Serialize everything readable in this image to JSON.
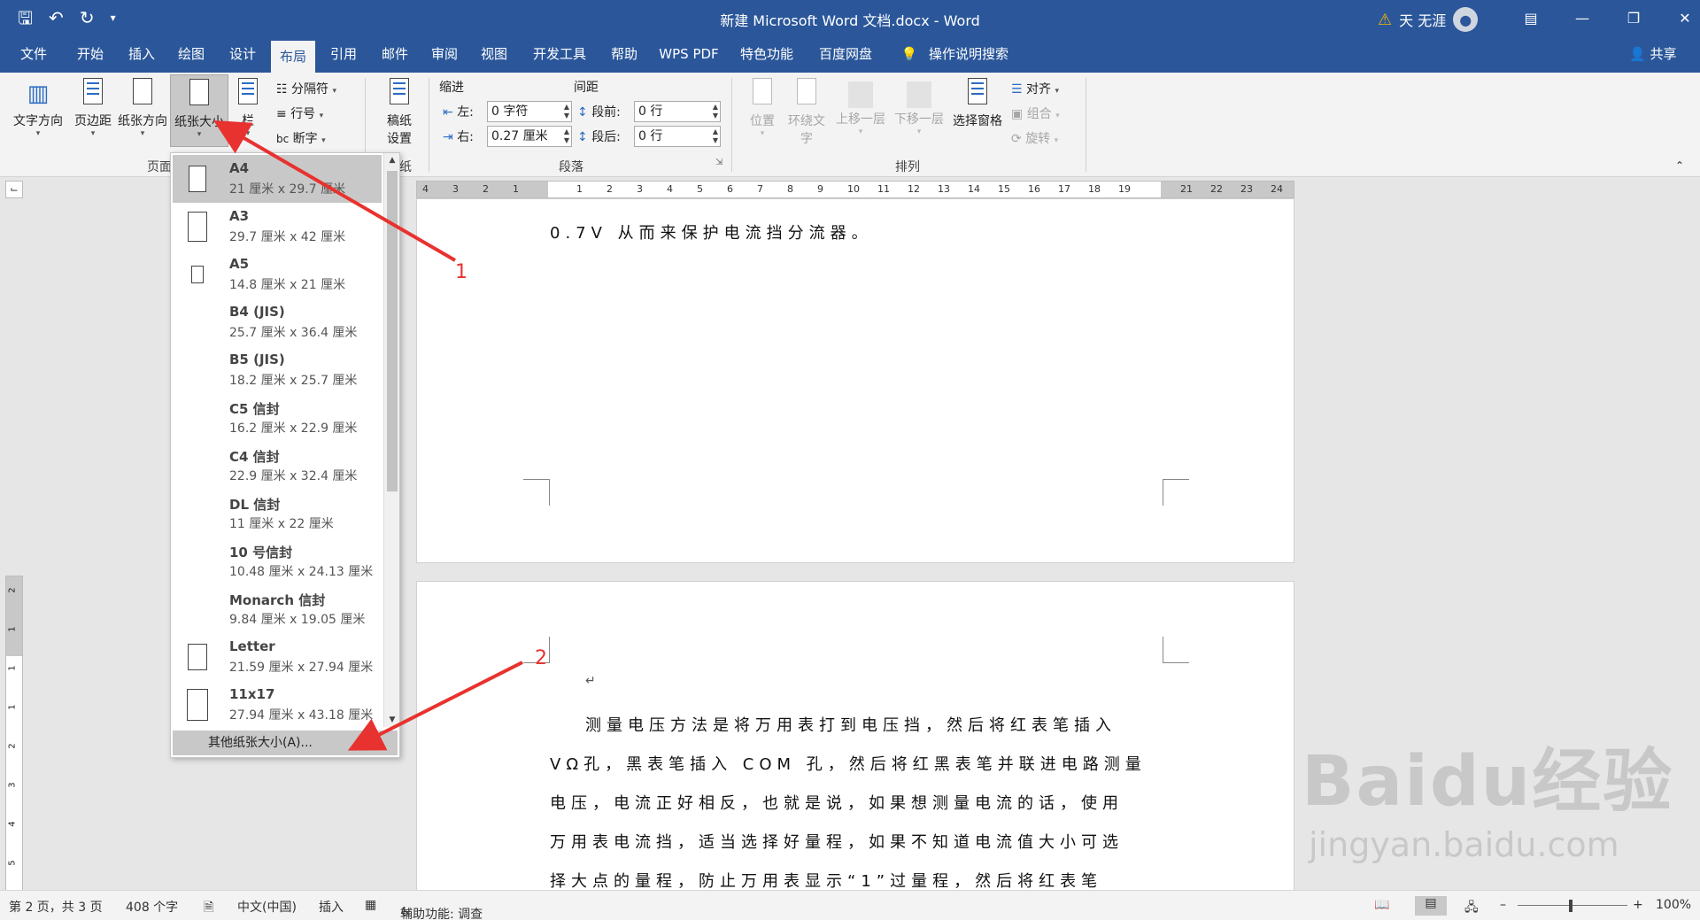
{
  "titlebar": {
    "title": "新建 Microsoft Word 文档.docx  -  Word",
    "user": "天 无涯",
    "qat": [
      "save-icon",
      "undo-icon",
      "redo-icon",
      "customize-icon"
    ],
    "window_buttons": [
      "ribbon-display-icon",
      "minimize-icon",
      "restore-icon",
      "close-icon"
    ]
  },
  "tabs": [
    "文件",
    "开始",
    "插入",
    "绘图",
    "设计",
    "布局",
    "引用",
    "邮件",
    "审阅",
    "视图",
    "开发工具",
    "帮助",
    "WPS PDF",
    "特色功能",
    "百度网盘",
    "操作说明搜索"
  ],
  "active_tab": "布局",
  "share": "共享",
  "ribbon": {
    "page_setup": {
      "text_direction": "文字方向",
      "margins": "页边距",
      "orientation": "纸张方向",
      "size": "纸张大小",
      "columns": "栏",
      "breaks": "分隔符",
      "line_numbers": "行号",
      "hyphenation": "断字",
      "group_label": "页面"
    },
    "manuscript": {
      "label": "稿纸\n设置",
      "line1": "稿纸",
      "line2": "设置",
      "group_label": "纸"
    },
    "paragraph": {
      "indent_label": "缩进",
      "spacing_label": "间距",
      "left_label": "左:",
      "left_value": "0 字符",
      "right_label": "右:",
      "right_value": "0.27 厘米",
      "before_label": "段前:",
      "before_value": "0 行",
      "after_label": "段后:",
      "after_value": "0 行",
      "group_label": "段落"
    },
    "arrange": {
      "position": "位置",
      "wrap_text_1": "环绕文",
      "wrap_text_2": "字",
      "bring_forward": "上移一层",
      "send_backward": "下移一层",
      "selection_pane": "选择窗格",
      "align": "对齐",
      "group": "组合",
      "rotate": "旋转",
      "group_label": "排列"
    }
  },
  "ruler": {
    "numbers": [
      "4",
      "3",
      "2",
      "1",
      "1",
      "2",
      "3",
      "4",
      "5",
      "6",
      "7",
      "8",
      "9",
      "10",
      "11",
      "12",
      "13",
      "14",
      "15",
      "16",
      "17",
      "18",
      "19",
      "21",
      "22",
      "23",
      "24"
    ],
    "vertical": [
      "2",
      "1",
      "1",
      "1",
      "2",
      "3",
      "4",
      "5"
    ]
  },
  "document": {
    "page1_line": "0.7V 从而来保护电流挡分流器。",
    "page2_lines": [
      "测量电压方法是将万用表打到电压挡，然后将红表笔插入",
      "VΩ孔，黑表笔插入 COM 孔，然后将红黑表笔并联进电路测量",
      "电压，电流正好相反，也就是说，如果想测量电流的话，使用",
      "万用表电流挡，适当选择好量程，如果不知道电流值大小可选",
      "择大点的量程，防止万用表显示“1”过量程，然后将红表笔"
    ]
  },
  "paper_sizes": [
    {
      "name": "A4",
      "dims": "21 厘米 x 29.7 厘米"
    },
    {
      "name": "A3",
      "dims": "29.7 厘米 x 42 厘米"
    },
    {
      "name": "A5",
      "dims": "14.8 厘米 x 21 厘米"
    },
    {
      "name": "B4 (JIS)",
      "dims": "25.7 厘米 x 36.4 厘米"
    },
    {
      "name": "B5 (JIS)",
      "dims": "18.2 厘米 x 25.7 厘米"
    },
    {
      "name": "C5 信封",
      "dims": "16.2 厘米 x 22.9 厘米"
    },
    {
      "name": "C4 信封",
      "dims": "22.9 厘米 x 32.4 厘米"
    },
    {
      "name": "DL 信封",
      "dims": "11 厘米 x 22 厘米"
    },
    {
      "name": "10 号信封",
      "dims": "10.48 厘米 x 24.13 厘米"
    },
    {
      "name": "Monarch 信封",
      "dims": "9.84 厘米 x 19.05 厘米"
    },
    {
      "name": "Letter",
      "dims": "21.59 厘米 x 27.94 厘米"
    },
    {
      "name": "11x17",
      "dims": "27.94 厘米 x 43.18 厘米"
    }
  ],
  "selected_paper": "A4",
  "more_sizes": "其他纸张大小(A)...",
  "annotations": {
    "label1": "1",
    "label2": "2",
    "color": "#e8322f"
  },
  "statusbar": {
    "page": "第 2 页，共 3 页",
    "words": "408 个字",
    "language": "中文(中国)",
    "mode": "插入",
    "accessibility": "辅助功能: 调查",
    "zoom": "100%"
  },
  "watermark": {
    "brand": "Baidu经验",
    "url": "jingyan.baidu.com"
  },
  "colors": {
    "accent": "#2b579a",
    "ribbon": "#f3f3f3",
    "selected": "#c8c8c8"
  }
}
